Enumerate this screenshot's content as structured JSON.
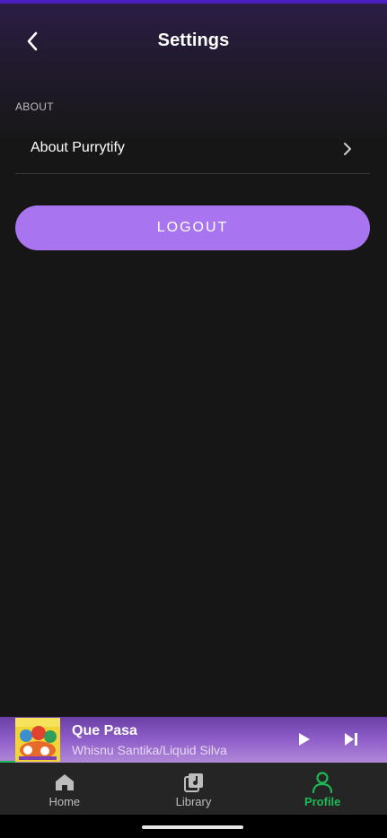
{
  "header": {
    "title": "Settings",
    "back_icon": "chevron-left-icon"
  },
  "sections": [
    {
      "label": "ABOUT",
      "items": [
        {
          "label": "About Purrytify",
          "icon": "chevron-right-icon"
        }
      ]
    }
  ],
  "logout": {
    "label": "LOGOUT",
    "color": "#a874f0"
  },
  "now_playing": {
    "title": "Que Pasa",
    "artist": "Whisnu Santika/Liquid Silva",
    "progress": 0.04,
    "play_icon": "play-icon",
    "next_icon": "skip-next-icon"
  },
  "bottom_nav": {
    "items": [
      {
        "label": "Home",
        "icon": "home-icon",
        "active": false
      },
      {
        "label": "Library",
        "icon": "library-icon",
        "active": false
      },
      {
        "label": "Profile",
        "icon": "profile-icon",
        "active": true
      }
    ],
    "active_color": "#1db954"
  },
  "colors": {
    "background": "#161616",
    "accent": "#1db954",
    "button": "#a874f0"
  }
}
